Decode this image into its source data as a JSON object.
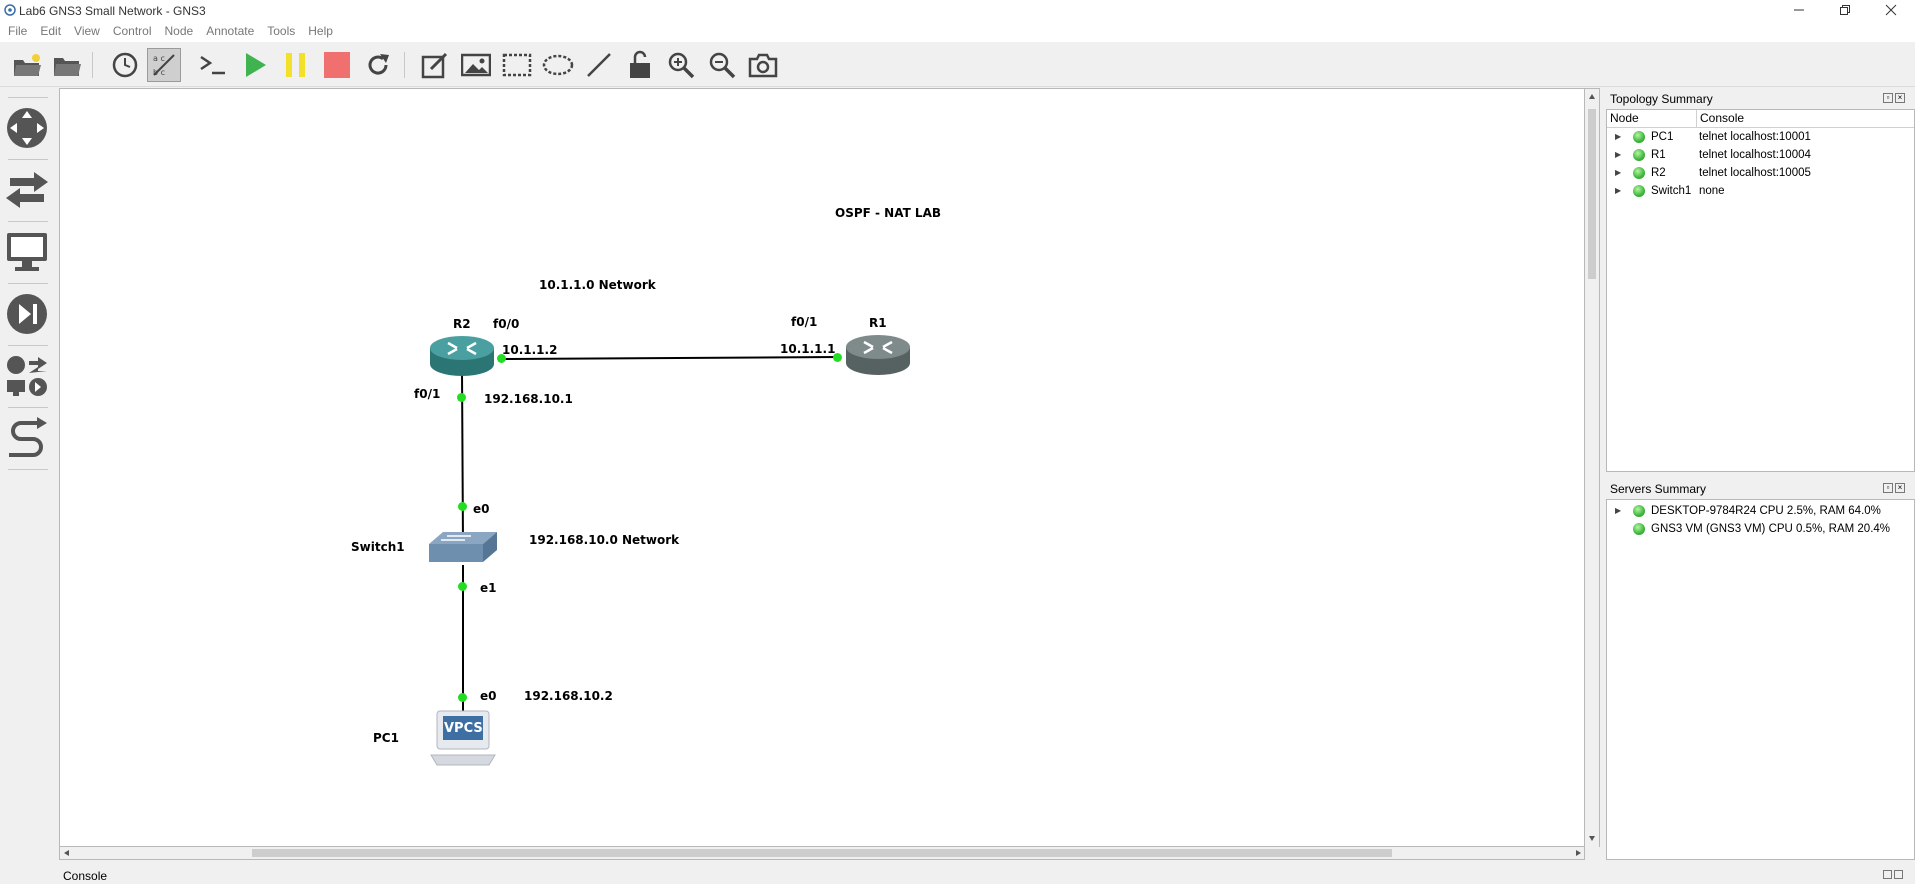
{
  "window": {
    "title": "Lab6 GNS3 Small Network - GNS3",
    "controls": [
      "minimize",
      "maximize",
      "close"
    ]
  },
  "menu": [
    "File",
    "Edit",
    "View",
    "Control",
    "Node",
    "Annotate",
    "Tools",
    "Help"
  ],
  "toolbar": [
    {
      "name": "open-project-icon"
    },
    {
      "name": "open-folder-icon"
    },
    {
      "name": "snapshot-clock-icon"
    },
    {
      "name": "show-interface-labels-icon",
      "active": true
    },
    {
      "name": "console-all-icon"
    },
    {
      "name": "start-all-icon",
      "color": "#3fb34f"
    },
    {
      "name": "suspend-all-icon",
      "color": "#f2e02a"
    },
    {
      "name": "stop-all-icon",
      "color": "#f07070"
    },
    {
      "name": "reload-all-icon"
    },
    {
      "name": "add-note-icon"
    },
    {
      "name": "insert-picture-icon"
    },
    {
      "name": "draw-rectangle-icon"
    },
    {
      "name": "draw-ellipse-icon"
    },
    {
      "name": "draw-line-icon"
    },
    {
      "name": "lock-unlock-icon"
    },
    {
      "name": "zoom-in-icon"
    },
    {
      "name": "zoom-out-icon"
    },
    {
      "name": "screenshot-icon"
    }
  ],
  "left_dock": [
    {
      "name": "browse-routers-icon"
    },
    {
      "name": "browse-switches-icon"
    },
    {
      "name": "browse-end-devices-icon"
    },
    {
      "name": "browse-security-devices-icon"
    },
    {
      "name": "browse-all-devices-icon"
    },
    {
      "name": "add-link-icon"
    }
  ],
  "topology": {
    "title": "OSPF - NAT LAB",
    "network1_label": "10.1.1.0 Network",
    "network2_label": "192.168.10.0 Network",
    "nodes": {
      "r2": {
        "label": "R2",
        "color": "#3a8f8f"
      },
      "r1": {
        "label": "R1",
        "color": "#6f7a7a"
      },
      "switch1": {
        "label": "Switch1"
      },
      "pc1": {
        "label": "PC1",
        "screen_text": "VPCS"
      }
    },
    "links": [
      {
        "a_port": "f0/0",
        "a_ip": "10.1.1.2",
        "b_port": "f0/1",
        "b_ip": "10.1.1.1"
      },
      {
        "a_port": "f0/1",
        "a_ip": "192.168.10.1",
        "b_port": "e0"
      },
      {
        "a_port": "e1",
        "b_port": "e0",
        "b_ip": "192.168.10.2"
      }
    ],
    "link_status_color": "#22dd22"
  },
  "topology_summary": {
    "title": "Topology Summary",
    "columns": [
      "Node",
      "Console"
    ],
    "rows": [
      {
        "node": "PC1",
        "console": "telnet localhost:10001"
      },
      {
        "node": "R1",
        "console": "telnet localhost:10004"
      },
      {
        "node": "R2",
        "console": "telnet localhost:10005"
      },
      {
        "node": "Switch1",
        "console": "none"
      }
    ]
  },
  "servers_summary": {
    "title": "Servers Summary",
    "rows": [
      {
        "text": "DESKTOP-9784R24 CPU 2.5%, RAM 64.0%",
        "expandable": true
      },
      {
        "text": "GNS3 VM (GNS3 VM) CPU 0.5%, RAM 20.4%",
        "expandable": false
      }
    ]
  },
  "console": {
    "label": "Console"
  }
}
